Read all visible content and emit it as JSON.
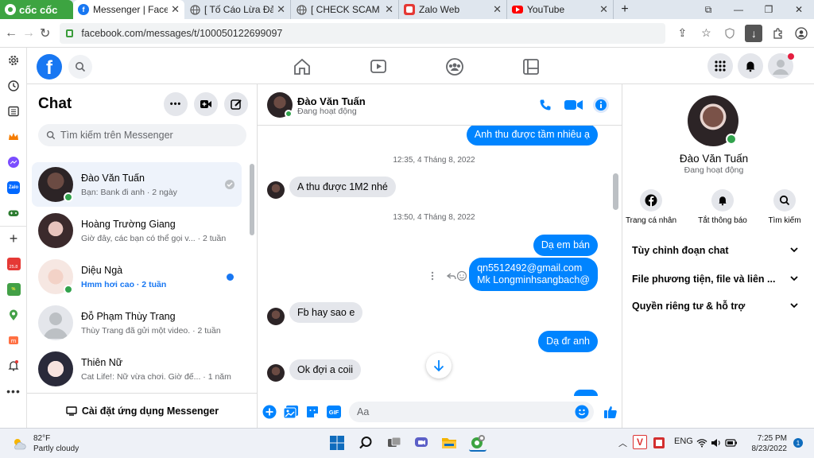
{
  "browser": {
    "logo_text": "cốc cốc",
    "tabs": [
      {
        "title": "Messenger | Faceb",
        "active": true
      },
      {
        "title": "[ Tố Cáo Lừa Đảo",
        "active": false
      },
      {
        "title": "[ CHECK SCAM ] H",
        "active": false
      },
      {
        "title": "Zalo Web",
        "active": false
      },
      {
        "title": "YouTube",
        "active": false
      }
    ],
    "new_tab": "+",
    "url": "facebook.com/messages/t/100050122699097"
  },
  "chat_list": {
    "title": "Chat",
    "search_placeholder": "Tìm kiếm trên Messenger",
    "items": [
      {
        "name": "Đào Văn Tuấn",
        "preview": "Bạn: Bank đi anh · 2 ngày",
        "online": true,
        "selected": true
      },
      {
        "name": "Hoàng Trường Giang",
        "preview": "Giờ đây, các bạn có thể gọi v... · 2 tuần",
        "online": false
      },
      {
        "name": "Diệu Ngà",
        "preview": "Hmm hơi cao · 2 tuần",
        "online": true,
        "unread": true
      },
      {
        "name": "Đỗ Phạm Thùy Trang",
        "preview": "Thùy Trang đã gửi một video. · 2 tuần",
        "online": false
      },
      {
        "name": "Thiên Nữ",
        "preview": "Cat Life!: Nữ vừa chơi. Giờ đế... · 1 năm",
        "online": false
      }
    ],
    "install_label": "Cài đặt ứng dụng Messenger"
  },
  "conversation": {
    "name": "Đào Văn Tuấn",
    "status": "Đang hoạt động",
    "messages": {
      "m1": "Anh thu được tầm nhiêu ạ",
      "t1": "12:35, 4 Tháng 8, 2022",
      "m2": "A thu được 1M2 nhé",
      "t2": "13:50, 4 Tháng 8, 2022",
      "m3": "Dạ em bán",
      "m4_line1": "qn5512492@gmail.com",
      "m4_line2": "Mk Longminhsangbach@",
      "m5": "Fb hay sao e",
      "m6": "Dạ đr anh",
      "m7": "Ok đợi a coii"
    },
    "composer_placeholder": "Aa",
    "gif_label": "GIF"
  },
  "info_panel": {
    "name": "Đào Văn Tuấn",
    "status": "Đang hoạt động",
    "actions": [
      "Trang cá nhân",
      "Tắt thông báo",
      "Tìm kiếm"
    ],
    "sections": [
      "Tùy chỉnh đoạn chat",
      "File phương tiện, file và liên ...",
      "Quyền riêng tư & hỗ trợ"
    ]
  },
  "taskbar": {
    "temp": "82°F",
    "weather": "Partly cloudy",
    "lang": "ENG",
    "time": "7:25 PM",
    "date": "8/23/2022",
    "notif_count": "1"
  },
  "colors": {
    "messenger_blue": "#0084ff",
    "fb_blue": "#1877f2",
    "online_green": "#31a24c",
    "coccoc_green": "#3da441"
  }
}
